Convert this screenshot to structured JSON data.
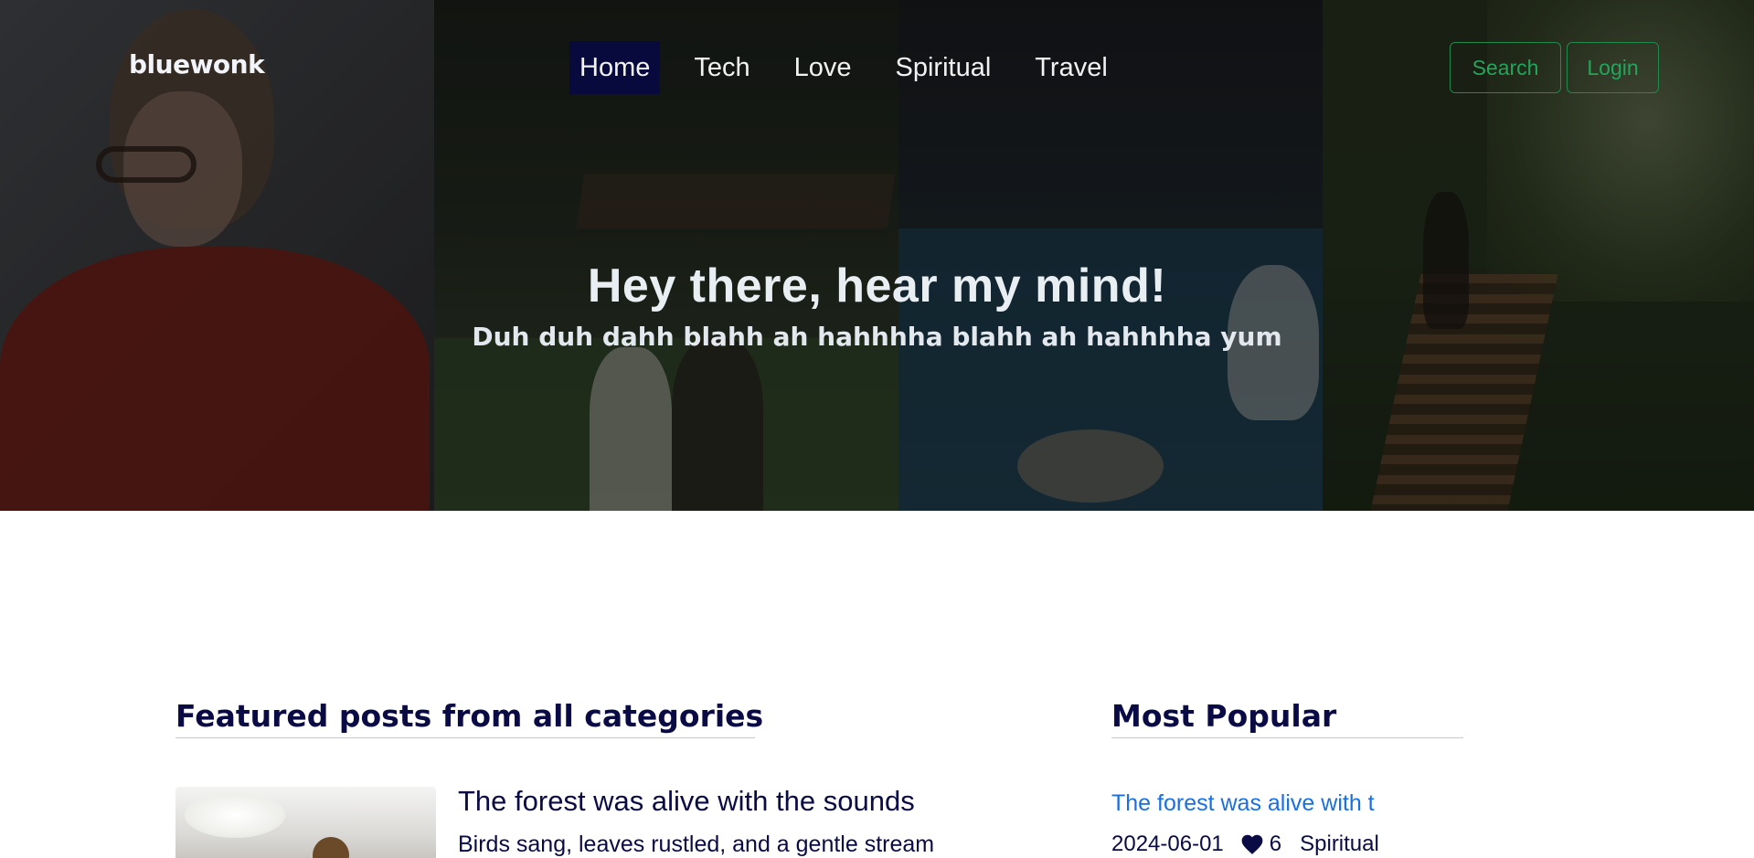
{
  "header": {
    "brand": "bluewonk",
    "nav": [
      {
        "label": "Home",
        "active": true
      },
      {
        "label": "Tech",
        "active": false
      },
      {
        "label": "Love",
        "active": false
      },
      {
        "label": "Spiritual",
        "active": false
      },
      {
        "label": "Travel",
        "active": false
      }
    ],
    "search_label": "Search",
    "login_label": "Login"
  },
  "hero": {
    "title": "Hey there, hear my mind!",
    "subtitle": "Duh duh dahh blahh ah hahhhha blahh ah hahhhha yum"
  },
  "featured": {
    "heading": "Featured posts from all categories",
    "posts": [
      {
        "title": "The forest was alive with the sounds",
        "excerpt": "Birds sang, leaves rustled, and a gentle stream"
      }
    ]
  },
  "popular": {
    "heading": "Most Popular",
    "items": [
      {
        "title": "The forest was alive with t",
        "date": "2024-06-01",
        "likes": "6",
        "category": "Spiritual"
      }
    ]
  },
  "colors": {
    "navy": "#0a0a45",
    "active_nav_bg": "#08093c",
    "green_outline": "#23a55a",
    "link_blue": "#1a6fe3"
  }
}
